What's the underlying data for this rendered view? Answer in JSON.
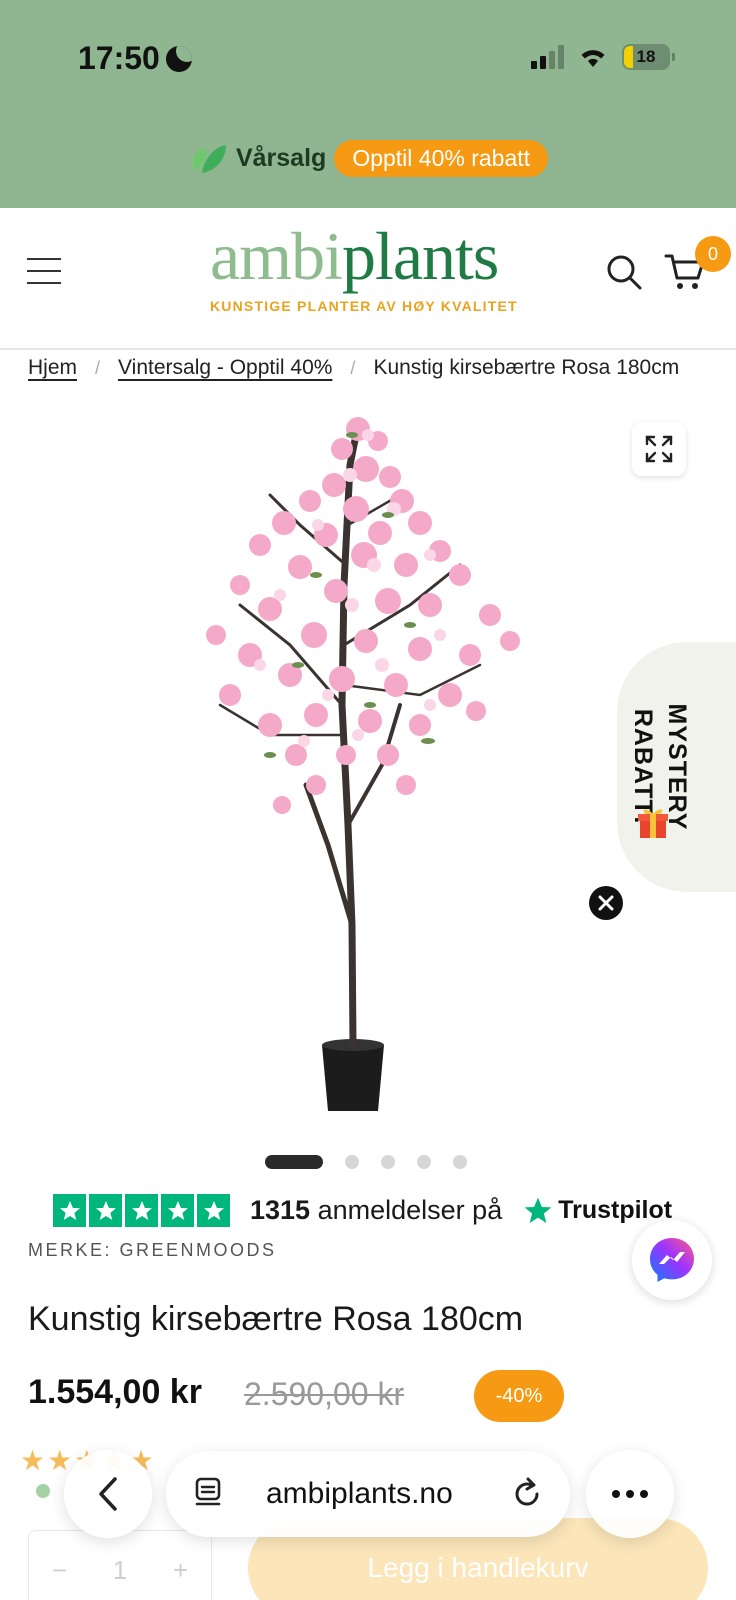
{
  "status_bar": {
    "time": "17:50",
    "battery": "18"
  },
  "promo": {
    "label": "Vårsalg",
    "pill": "Opptil 40% rabatt"
  },
  "header": {
    "logo_part1": "ambi",
    "logo_part2": "plants",
    "tagline": "KUNSTIGE PLANTER AV HØY KVALITET",
    "cart_count": "0"
  },
  "breadcrumb": {
    "home": "Hjem",
    "category": "Vintersalg - Opptil 40%",
    "current": "Kunstig kirsebærtre Rosa 180cm"
  },
  "gallery": {
    "image_count": 5,
    "active_index": 0
  },
  "mystery": {
    "line1": "MYSTERY",
    "line2": "RABATT!"
  },
  "trustpilot": {
    "count": "1315",
    "text": "anmeldelser på",
    "brand": "Trustpilot"
  },
  "product": {
    "brand": "MERKE: GREENMOODS",
    "title": "Kunstig kirsebærtre Rosa 180cm",
    "price": "1.554,00 kr",
    "old_price": "2.590,00 kr",
    "discount": "-40%",
    "quantity": "1",
    "add_to_cart": "Legg i handlekurv"
  },
  "browser": {
    "url": "ambiplants.no"
  },
  "colors": {
    "green_banner": "#8fb691",
    "orange": "#f59a12",
    "logo_light": "#8fbc8f",
    "logo_dark": "#1f7a44",
    "trustpilot": "#00b67a"
  }
}
